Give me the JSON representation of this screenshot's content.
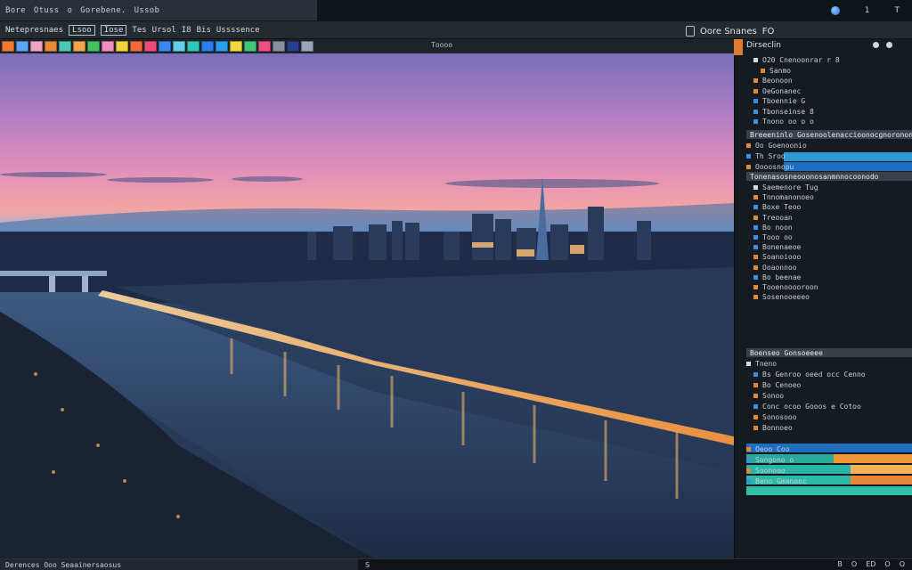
{
  "menubar": {
    "items": [
      "Bore",
      "Otuss",
      "o",
      "Gorebene.",
      "Ussob"
    ]
  },
  "document_tab": {
    "items": [
      "Netepresnaes",
      "Lsoo",
      "Iose",
      "Tes",
      "Ursol",
      "I8",
      "Bis",
      "Ussssence"
    ]
  },
  "topright": {
    "btn1": "1",
    "btn2": "T"
  },
  "canvas": {
    "label": "Toooo",
    "image_description": "Aerial city skyline at dusk with river and bridge"
  },
  "swatches": [
    "#f07d2f",
    "#5aa7f2",
    "#f3a4c6",
    "#e68a3a",
    "#48c9b5",
    "#f2a64a",
    "#3fc35d",
    "#f28fc0",
    "#f2d23a",
    "#f06a3a",
    "#ee4a7a",
    "#3a87f2",
    "#5fd0e8",
    "#2fc8b8",
    "#2a7cf0",
    "#2a9ef0",
    "#f2d83a",
    "#3dc778",
    "#ef4f82",
    "#8a8fa0",
    "#2a3f8f",
    "#9aa5b8"
  ],
  "panel": {
    "title": "Oore Snanes",
    "title_suffix": "FO",
    "header": "Dirseclin",
    "rows": [
      {
        "text": "O20 Cnenoonrar r 8",
        "bullet": "w",
        "indent": 1
      },
      {
        "text": "Sanmo",
        "bullet": "o",
        "indent": 2
      },
      {
        "text": "Beonoon",
        "bullet": "o",
        "indent": 1
      },
      {
        "text": "OeGonanec",
        "bullet": "o",
        "indent": 1
      },
      {
        "text": "Tboennie G",
        "bullet": "b",
        "indent": 1
      },
      {
        "text": "Tbonseinse 8",
        "bullet": "b",
        "indent": 1
      },
      {
        "text": "Tnono oo o o",
        "bullet": "b",
        "indent": 1
      }
    ],
    "section1": "Breeeninlo Gosenoolenaccioonocgnorononneeno",
    "sel_rows": [
      {
        "text": "Oo Goenoonio",
        "bullet": "o"
      },
      {
        "text": "Th Sroo",
        "bullet": "b"
      },
      {
        "text": "Oooosnopu",
        "bullet": "o"
      }
    ],
    "section2": "Tonenasosneooonosanmnnocoonodo",
    "rows2": [
      {
        "text": "Saemenore Tug",
        "bullet": "w",
        "indent": 1
      },
      {
        "text": "Tnnomanonoeo",
        "bullet": "o",
        "indent": 1
      },
      {
        "text": "Boxe Teoo",
        "bullet": "b",
        "indent": 1
      },
      {
        "text": "Treooan",
        "bullet": "o",
        "indent": 1
      },
      {
        "text": "Bo noon",
        "bullet": "b",
        "indent": 1
      },
      {
        "text": "Tooo oo",
        "bullet": "b",
        "indent": 1
      },
      {
        "text": "Bonenaeoe",
        "bullet": "b",
        "indent": 1
      },
      {
        "text": "Soanoiooo",
        "bullet": "o",
        "indent": 1
      },
      {
        "text": "Ooaonnoo",
        "bullet": "o",
        "indent": 1
      },
      {
        "text": "Bo beenae",
        "bullet": "b",
        "indent": 1
      },
      {
        "text": "Tooenooooroon",
        "bullet": "o",
        "indent": 1
      },
      {
        "text": "Sosenooeeeo",
        "bullet": "o",
        "indent": 1
      }
    ],
    "section3": "Boenseo Gonsoeeee",
    "rows3": [
      {
        "text": "Tneno",
        "bullet": "w",
        "indent": 0
      },
      {
        "text": "Bs Genroo oeed occ Cenno",
        "bullet": "b",
        "indent": 1
      },
      {
        "text": "Bo Cenoeo",
        "bullet": "o",
        "indent": 1
      },
      {
        "text": "Sonoo",
        "bullet": "o",
        "indent": 1
      },
      {
        "text": "Conc ocoo Gooos e Cotoo",
        "bullet": "b",
        "indent": 1
      },
      {
        "text": "Sonosooo",
        "bullet": "o",
        "indent": 1
      },
      {
        "text": "Bonnoeo",
        "bullet": "o",
        "indent": 1
      }
    ],
    "layers": [
      {
        "text": "Oeoo Coo",
        "bullet": "o"
      },
      {
        "text": "Songono o",
        "bullet": "b"
      },
      {
        "text": "Soonooo",
        "bullet": "o"
      },
      {
        "text": "Beno Gmanonc",
        "bullet": "b"
      }
    ]
  },
  "status": {
    "left": "Derences Ooo Seaainersaosus",
    "mid": "S",
    "right": [
      "B",
      "O",
      "ED",
      "O",
      "O"
    ]
  }
}
